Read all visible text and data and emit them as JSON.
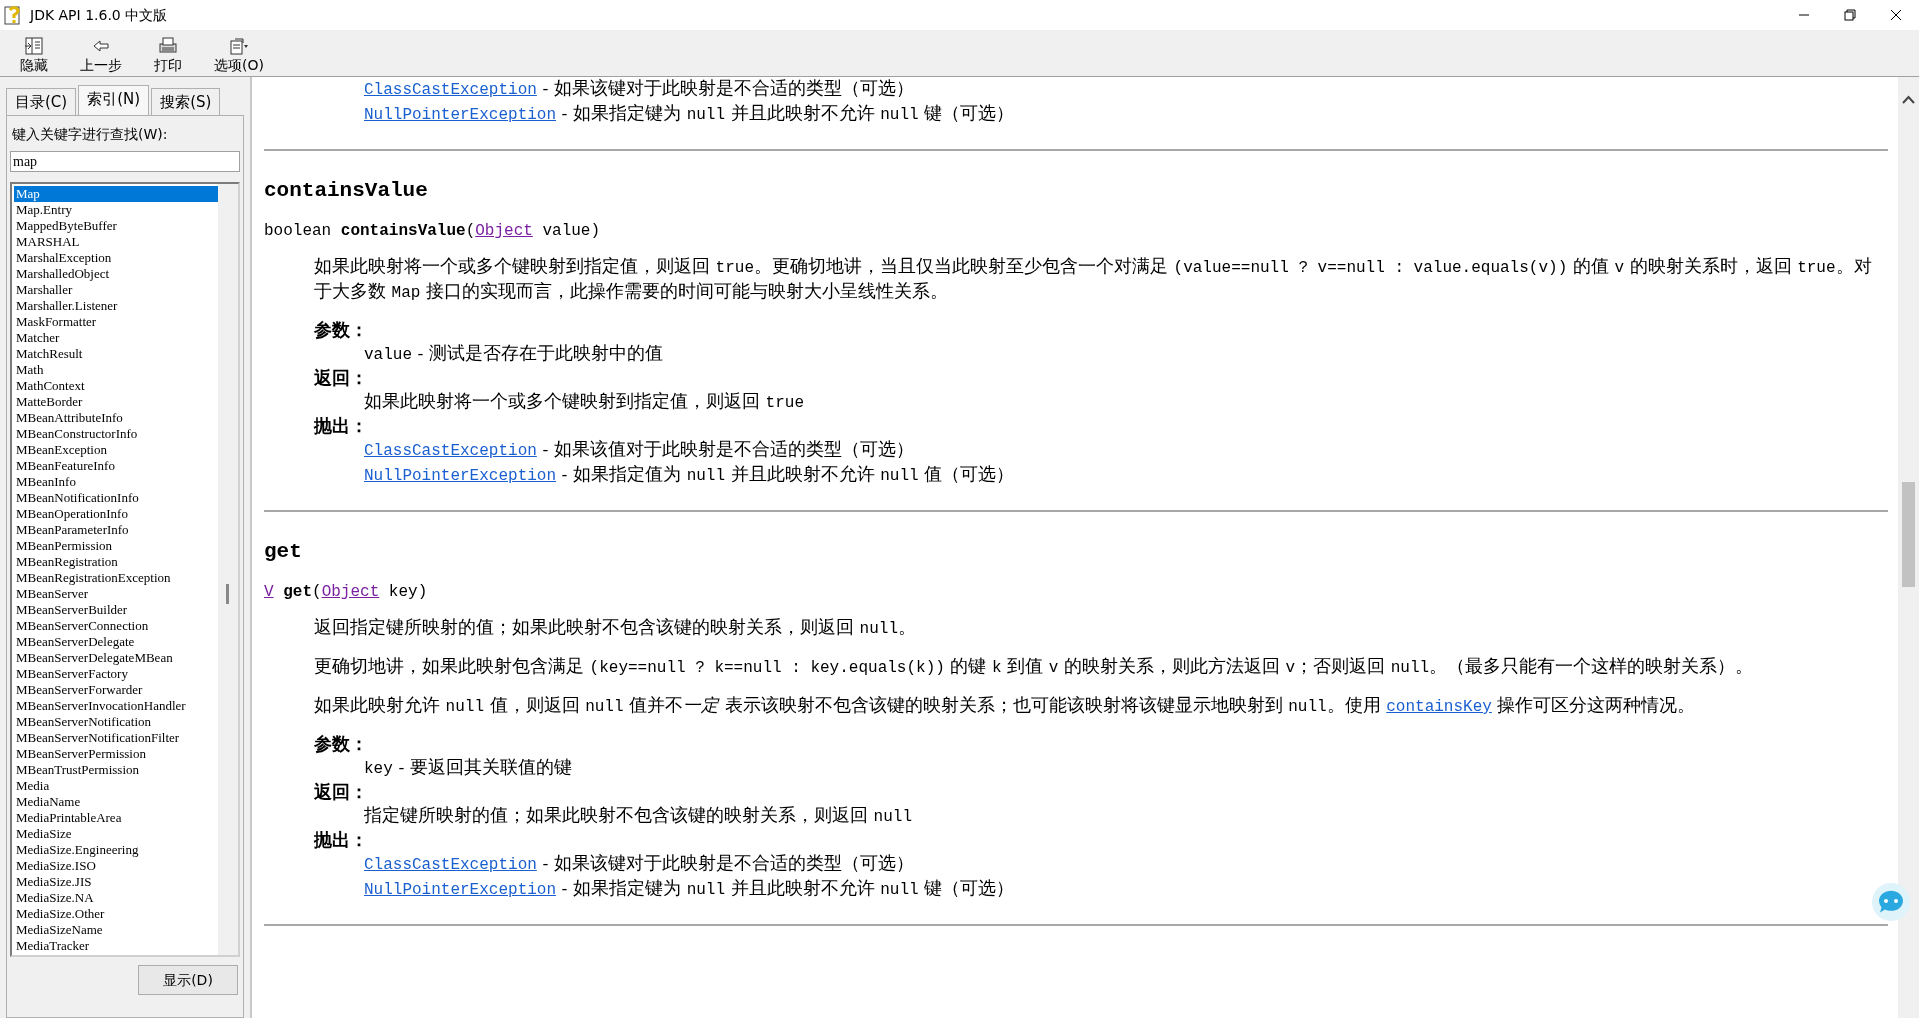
{
  "window": {
    "title": "JDK API 1.6.0 中文版"
  },
  "toolbar": [
    {
      "kind": "hide",
      "label": "隐藏"
    },
    {
      "kind": "back",
      "label": "上一步"
    },
    {
      "kind": "print",
      "label": "打印"
    },
    {
      "kind": "options",
      "label": "选项(O)"
    }
  ],
  "tabs": [
    {
      "label": "目录(C)",
      "selected": false
    },
    {
      "label": "索引(N)",
      "selected": true
    },
    {
      "label": "搜索(S)",
      "selected": false
    }
  ],
  "index_panel": {
    "prompt": "键入关键字进行查找(W):",
    "search": {
      "value": "map"
    },
    "items": [
      {
        "label": "Map",
        "selected": true
      },
      {
        "label": "Map.Entry",
        "selected": false
      },
      {
        "label": "MappedByteBuffer",
        "selected": false
      },
      {
        "label": "MARSHAL",
        "selected": false
      },
      {
        "label": "MarshalException",
        "selected": false
      },
      {
        "label": "MarshalledObject",
        "selected": false
      },
      {
        "label": "Marshaller",
        "selected": false
      },
      {
        "label": "Marshaller.Listener",
        "selected": false
      },
      {
        "label": "MaskFormatter",
        "selected": false
      },
      {
        "label": "Matcher",
        "selected": false
      },
      {
        "label": "MatchResult",
        "selected": false
      },
      {
        "label": "Math",
        "selected": false
      },
      {
        "label": "MathContext",
        "selected": false
      },
      {
        "label": "MatteBorder",
        "selected": false
      },
      {
        "label": "MBeanAttributeInfo",
        "selected": false
      },
      {
        "label": "MBeanConstructorInfo",
        "selected": false
      },
      {
        "label": "MBeanException",
        "selected": false
      },
      {
        "label": "MBeanFeatureInfo",
        "selected": false
      },
      {
        "label": "MBeanInfo",
        "selected": false
      },
      {
        "label": "MBeanNotificationInfo",
        "selected": false
      },
      {
        "label": "MBeanOperationInfo",
        "selected": false
      },
      {
        "label": "MBeanParameterInfo",
        "selected": false
      },
      {
        "label": "MBeanPermission",
        "selected": false
      },
      {
        "label": "MBeanRegistration",
        "selected": false
      },
      {
        "label": "MBeanRegistrationException",
        "selected": false
      },
      {
        "label": "MBeanServer",
        "selected": false
      },
      {
        "label": "MBeanServerBuilder",
        "selected": false
      },
      {
        "label": "MBeanServerConnection",
        "selected": false
      },
      {
        "label": "MBeanServerDelegate",
        "selected": false
      },
      {
        "label": "MBeanServerDelegateMBean",
        "selected": false
      },
      {
        "label": "MBeanServerFactory",
        "selected": false
      },
      {
        "label": "MBeanServerForwarder",
        "selected": false
      },
      {
        "label": "MBeanServerInvocationHandler",
        "selected": false
      },
      {
        "label": "MBeanServerNotification",
        "selected": false
      },
      {
        "label": "MBeanServerNotificationFilter",
        "selected": false
      },
      {
        "label": "MBeanServerPermission",
        "selected": false
      },
      {
        "label": "MBeanTrustPermission",
        "selected": false
      },
      {
        "label": "Media",
        "selected": false
      },
      {
        "label": "MediaName",
        "selected": false
      },
      {
        "label": "MediaPrintableArea",
        "selected": false
      },
      {
        "label": "MediaSize",
        "selected": false
      },
      {
        "label": "MediaSize.Engineering",
        "selected": false
      },
      {
        "label": "MediaSize.ISO",
        "selected": false
      },
      {
        "label": "MediaSize.JIS",
        "selected": false
      },
      {
        "label": "MediaSize.NA",
        "selected": false
      },
      {
        "label": "MediaSize.Other",
        "selected": false
      },
      {
        "label": "MediaSizeName",
        "selected": false
      },
      {
        "label": "MediaTracker",
        "selected": false
      }
    ],
    "display_button": "显示(D)"
  },
  "content": {
    "top_throws": [
      [
        {
          "kind": "link",
          "text": "ClassCastException",
          "visited": false
        },
        {
          "kind": "text",
          "text": " - 如果该键对于此映射是不合适的类型（可选）"
        }
      ],
      [
        {
          "kind": "link",
          "text": "NullPointerException",
          "visited": false
        },
        {
          "kind": "text",
          "text": " - 如果指定键为 "
        },
        {
          "kind": "code",
          "text": "null"
        },
        {
          "kind": "text",
          "text": " 并且此映射不允许 "
        },
        {
          "kind": "code",
          "text": "null"
        },
        {
          "kind": "text",
          "text": " 键（可选）"
        }
      ]
    ],
    "methods": [
      {
        "name": "containsValue",
        "signature": [
          {
            "kind": "code",
            "text": "boolean "
          },
          {
            "kind": "bold",
            "text": "containsValue"
          },
          {
            "kind": "code",
            "text": "("
          },
          {
            "kind": "link",
            "text": "Object",
            "visited": true
          },
          {
            "kind": "code",
            "text": " value)"
          }
        ],
        "paragraphs": [
          [
            {
              "kind": "text",
              "text": "如果此映射将一个或多个键映射到指定值，则返回 "
            },
            {
              "kind": "code",
              "text": "true"
            },
            {
              "kind": "text",
              "text": "。更确切地讲，当且仅当此映射至少包含一个对满足 "
            },
            {
              "kind": "code",
              "text": "(value==null ? v==null : value.equals(v))"
            },
            {
              "kind": "text",
              "text": " 的值 "
            },
            {
              "kind": "code",
              "text": "v"
            },
            {
              "kind": "text",
              "text": " 的映射关系时，返回 "
            },
            {
              "kind": "code",
              "text": "true"
            },
            {
              "kind": "text",
              "text": "。对于大多数 "
            },
            {
              "kind": "code",
              "text": "Map"
            },
            {
              "kind": "text",
              "text": " 接口的实现而言，此操作需要的时间可能与映射大小呈线性关系。"
            }
          ]
        ],
        "sections": [
          {
            "label": "参数：",
            "items": [
              [
                {
                  "kind": "code",
                  "text": "value"
                },
                {
                  "kind": "text",
                  "text": " - 测试是否存在于此映射中的值"
                }
              ]
            ]
          },
          {
            "label": "返回：",
            "items": [
              [
                {
                  "kind": "text",
                  "text": "如果此映射将一个或多个键映射到指定值，则返回 "
                },
                {
                  "kind": "code",
                  "text": "true"
                }
              ]
            ]
          },
          {
            "label": "抛出：",
            "items": [
              [
                {
                  "kind": "link",
                  "text": "ClassCastException",
                  "visited": false
                },
                {
                  "kind": "text",
                  "text": " - 如果该值对于此映射是不合适的类型（可选）"
                }
              ],
              [
                {
                  "kind": "link",
                  "text": "NullPointerException",
                  "visited": false
                },
                {
                  "kind": "text",
                  "text": " - 如果指定值为 "
                },
                {
                  "kind": "code",
                  "text": "null"
                },
                {
                  "kind": "text",
                  "text": " 并且此映射不允许 "
                },
                {
                  "kind": "code",
                  "text": "null"
                },
                {
                  "kind": "text",
                  "text": " 值（可选）"
                }
              ]
            ]
          }
        ]
      },
      {
        "name": "get",
        "signature": [
          {
            "kind": "link",
            "text": "V",
            "visited": true
          },
          {
            "kind": "bold",
            "text": "get"
          },
          {
            "kind": "code",
            "text": "("
          },
          {
            "kind": "link",
            "text": "Object",
            "visited": true
          },
          {
            "kind": "code",
            "text": " key)"
          }
        ],
        "paragraphs": [
          [
            {
              "kind": "text",
              "text": "返回指定键所映射的值；如果此映射不包含该键的映射关系，则返回 "
            },
            {
              "kind": "code",
              "text": "null"
            },
            {
              "kind": "text",
              "text": "。"
            }
          ],
          [
            {
              "kind": "text",
              "text": "更确切地讲，如果此映射包含满足 "
            },
            {
              "kind": "code",
              "text": "(key==null ? k==null : key.equals(k))"
            },
            {
              "kind": "text",
              "text": " 的键 "
            },
            {
              "kind": "code",
              "text": "k"
            },
            {
              "kind": "text",
              "text": " 到值 "
            },
            {
              "kind": "code",
              "text": "v"
            },
            {
              "kind": "text",
              "text": " 的映射关系，则此方法返回 "
            },
            {
              "kind": "code",
              "text": "v"
            },
            {
              "kind": "text",
              "text": "；否则返回 "
            },
            {
              "kind": "code",
              "text": "null"
            },
            {
              "kind": "text",
              "text": "。（最多只能有一个这样的映射关系）。"
            }
          ],
          [
            {
              "kind": "text",
              "text": "如果此映射允许 "
            },
            {
              "kind": "code",
              "text": "null"
            },
            {
              "kind": "text",
              "text": " 值，则返回 "
            },
            {
              "kind": "code",
              "text": "null"
            },
            {
              "kind": "text",
              "text": " 值并不"
            },
            {
              "kind": "italic",
              "text": "一定"
            },
            {
              "kind": "text",
              "text": " 表示该映射不包含该键的映射关系；也可能该映射将该键显示地映射到 "
            },
            {
              "kind": "code",
              "text": "null"
            },
            {
              "kind": "text",
              "text": "。使用 "
            },
            {
              "kind": "link",
              "text": "containsKey",
              "visited": false
            },
            {
              "kind": "text",
              "text": " 操作可区分这两种情况。"
            }
          ]
        ],
        "sections": [
          {
            "label": "参数：",
            "items": [
              [
                {
                  "kind": "code",
                  "text": "key"
                },
                {
                  "kind": "text",
                  "text": " - 要返回其关联值的键"
                }
              ]
            ]
          },
          {
            "label": "返回：",
            "items": [
              [
                {
                  "kind": "text",
                  "text": "指定键所映射的值；如果此映射不包含该键的映射关系，则返回 "
                },
                {
                  "kind": "code",
                  "text": "null"
                }
              ]
            ]
          },
          {
            "label": "抛出：",
            "items": [
              [
                {
                  "kind": "link",
                  "text": "ClassCastException",
                  "visited": false
                },
                {
                  "kind": "text",
                  "text": " - 如果该键对于此映射是不合适的类型（可选）"
                }
              ],
              [
                {
                  "kind": "link",
                  "text": "NullPointerException",
                  "visited": false
                },
                {
                  "kind": "text",
                  "text": " - 如果指定键为 "
                },
                {
                  "kind": "code",
                  "text": "null"
                },
                {
                  "kind": "text",
                  "text": " 并且此映射不允许 "
                },
                {
                  "kind": "code",
                  "text": "null"
                },
                {
                  "kind": "text",
                  "text": " 键（可选）"
                }
              ]
            ]
          }
        ]
      }
    ]
  }
}
